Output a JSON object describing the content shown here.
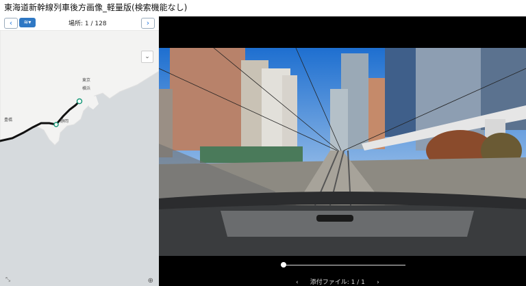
{
  "app": {
    "title": "東海道新幹線列車後方画像_軽量版(検索機能なし)"
  },
  "toolbar": {
    "prev_label": "‹",
    "next_label": "›",
    "layer_label": "≋▾",
    "place_label": "場所: 1 / 128"
  },
  "map": {
    "labels": {
      "tokyo": "東京",
      "yokohama": "横浜",
      "toyohashi": "豊橋",
      "shizuoka": "静岡"
    },
    "collapse_icon": "⌄",
    "expand_icon": "⤡",
    "zoom_icon": "⊕"
  },
  "viewer": {
    "attachment_label": "添付ファイル: 1 / 1",
    "attach_prev": "‹",
    "attach_next": "›",
    "slider_fraction": 0.0
  }
}
